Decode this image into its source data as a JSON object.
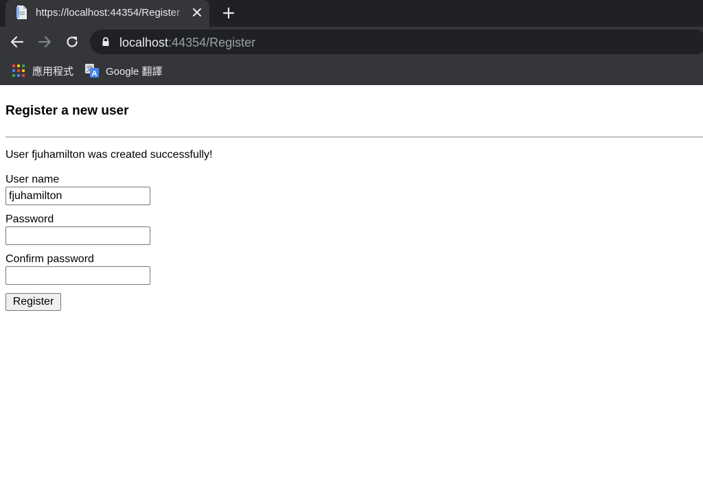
{
  "browser": {
    "tab": {
      "title": "https://localhost:44354/Register",
      "close_icon": "close-icon",
      "favicon": "page-icon"
    },
    "new_tab_icon": "plus-icon",
    "nav": {
      "back_icon": "arrow-left-icon",
      "forward_icon": "arrow-right-icon",
      "reload_icon": "reload-icon"
    },
    "address_bar": {
      "lock_icon": "lock-icon",
      "url_host": "localhost",
      "url_rest": ":44354/Register"
    },
    "bookmarks": [
      {
        "label": "應用程式",
        "icon": "apps-grid-icon"
      },
      {
        "label": "Google 翻譯",
        "icon": "google-translate-icon"
      }
    ],
    "colors": {
      "tabstrip": "#202124",
      "toolbar": "#35363a",
      "text": "#e8eaed",
      "muted": "#9aa0a6"
    }
  },
  "page": {
    "title": "Register a new user",
    "message": "User fjuhamilton was created successfully!",
    "form": {
      "username_label": "User name",
      "username_value": "fjuhamilton",
      "password_label": "Password",
      "password_value": "",
      "confirm_label": "Confirm password",
      "confirm_value": "",
      "submit_label": "Register"
    }
  }
}
